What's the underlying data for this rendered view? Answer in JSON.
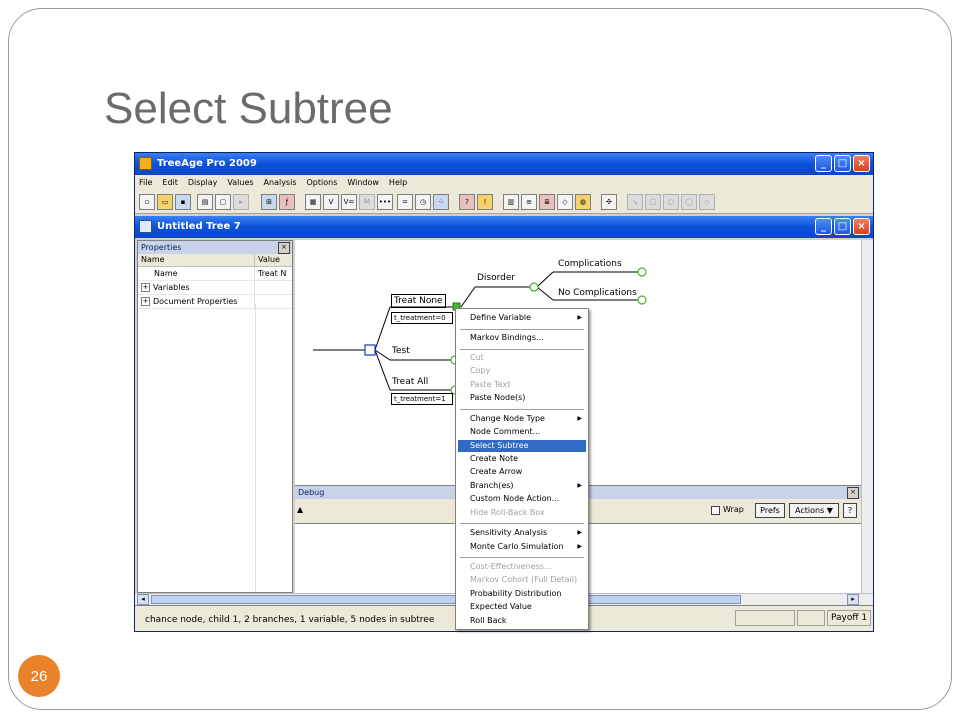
{
  "slide": {
    "title": "Select Subtree",
    "page_number": "26"
  },
  "app": {
    "title": "TreeAge Pro 2009",
    "menu": [
      "File",
      "Edit",
      "Display",
      "Values",
      "Analysis",
      "Options",
      "Window",
      "Help"
    ],
    "doc_title": "Untitled Tree 7",
    "window_buttons": {
      "minimize": "_",
      "maximize": "□",
      "close": "×"
    }
  },
  "properties": {
    "header": "Properties",
    "col_name": "Name",
    "col_value": "Value",
    "rows": [
      {
        "name": "Name",
        "value": "Treat N"
      },
      {
        "name": "Variables",
        "value": ""
      },
      {
        "name": "Document Properties",
        "value": ""
      }
    ]
  },
  "tree": {
    "treat_none": "Treat None",
    "treat_none_var": "t_treatment=0",
    "test": "Test",
    "treat_all": "Treat All",
    "treat_all_var": "t_treatment=1",
    "disorder": "Disorder",
    "complications": "Complications",
    "no_complications": "No Complications"
  },
  "debug": {
    "header": "Debug",
    "wrap_label": "Wrap",
    "prefs": "Prefs",
    "actions": "Actions ▼",
    "help": "?"
  },
  "context_menu": {
    "items": [
      {
        "label": "Define Variable",
        "submenu": true,
        "disabled": false
      },
      {
        "label": "Markov Bindings...",
        "disabled": false
      },
      {
        "label": "Cut",
        "disabled": true
      },
      {
        "label": "Copy",
        "disabled": true
      },
      {
        "label": "Paste Text",
        "disabled": true
      },
      {
        "label": "Paste Node(s)",
        "disabled": false
      },
      {
        "label": "Change Node Type",
        "submenu": true,
        "disabled": false
      },
      {
        "label": "Node Comment...",
        "disabled": false
      },
      {
        "label": "Select Subtree",
        "disabled": false,
        "selected": true
      },
      {
        "label": "Create Note",
        "disabled": false
      },
      {
        "label": "Create Arrow",
        "disabled": false
      },
      {
        "label": "Branch(es)",
        "submenu": true,
        "disabled": false
      },
      {
        "label": "Custom Node Action...",
        "disabled": false
      },
      {
        "label": "Hide Roll-Back Box",
        "disabled": true
      },
      {
        "label": "Sensitivity Analysis",
        "submenu": true,
        "disabled": false
      },
      {
        "label": "Monte Carlo Simulation",
        "submenu": true,
        "disabled": false
      },
      {
        "label": "Cost-Effectiveness...",
        "disabled": true
      },
      {
        "label": "Markov Cohort (Full Detail)",
        "disabled": true
      },
      {
        "label": "Probability Distribution",
        "disabled": false
      },
      {
        "label": "Expected Value",
        "disabled": false
      },
      {
        "label": "Roll Back",
        "disabled": false
      }
    ]
  },
  "statusbar": {
    "text": "chance node, child 1, 2 branches, 1 variable, 5 nodes in subtree",
    "payoff": "Payoff 1"
  },
  "colors": {
    "title_blue": "#0b51d9",
    "menu_highlight": "#316ac5",
    "badge_orange": "#e8832a",
    "node_green": "#50b030",
    "node_blue": "#1a3ac8"
  }
}
